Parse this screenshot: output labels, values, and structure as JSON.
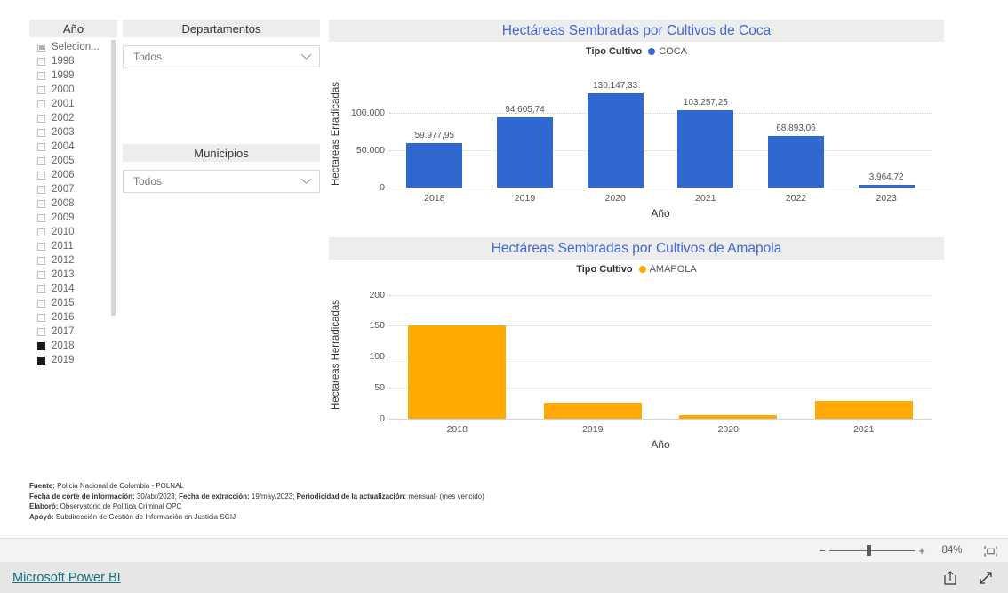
{
  "slicers": {
    "year": {
      "title": "Año",
      "items": [
        {
          "label": "Selecion...",
          "state": "indeterminate"
        },
        {
          "label": "1998",
          "state": "unchecked"
        },
        {
          "label": "1999",
          "state": "unchecked"
        },
        {
          "label": "2000",
          "state": "unchecked"
        },
        {
          "label": "2001",
          "state": "unchecked"
        },
        {
          "label": "2002",
          "state": "unchecked"
        },
        {
          "label": "2003",
          "state": "unchecked"
        },
        {
          "label": "2004",
          "state": "unchecked"
        },
        {
          "label": "2005",
          "state": "unchecked"
        },
        {
          "label": "2006",
          "state": "unchecked"
        },
        {
          "label": "2007",
          "state": "unchecked"
        },
        {
          "label": "2008",
          "state": "unchecked"
        },
        {
          "label": "2009",
          "state": "unchecked"
        },
        {
          "label": "2010",
          "state": "unchecked"
        },
        {
          "label": "2011",
          "state": "unchecked"
        },
        {
          "label": "2012",
          "state": "unchecked"
        },
        {
          "label": "2013",
          "state": "unchecked"
        },
        {
          "label": "2014",
          "state": "unchecked"
        },
        {
          "label": "2015",
          "state": "unchecked"
        },
        {
          "label": "2016",
          "state": "unchecked"
        },
        {
          "label": "2017",
          "state": "unchecked"
        },
        {
          "label": "2018",
          "state": "checked"
        },
        {
          "label": "2019",
          "state": "checked"
        }
      ]
    },
    "departamentos": {
      "title": "Departamentos",
      "value": "Todos",
      "icon": "chevron-down-icon"
    },
    "municipios": {
      "title": "Municipios",
      "value": "Todos",
      "icon": "chevron-down-icon"
    }
  },
  "chart_data": [
    {
      "type": "bar",
      "title": "Hectáreas Sembradas por Cultivos de Coca",
      "legend_title": "Tipo Cultivo",
      "legend_entries": [
        "COCA"
      ],
      "legend_position": "top",
      "color": "#2f68ce",
      "xlabel": "Año",
      "ylabel": "Hectareas Erradicadas",
      "categories": [
        "2018",
        "2019",
        "2020",
        "2021",
        "2022",
        "2023"
      ],
      "values": [
        59977.95,
        94605.74,
        130147.33,
        103257.25,
        68893.06,
        3964.72
      ],
      "value_labels": [
        "59.977,95",
        "94.605,74",
        "130.147,33",
        "103.257,25",
        "68.893,06",
        "3.964,72"
      ],
      "yticks": [
        0,
        50000,
        100000
      ],
      "ytick_labels": [
        "0",
        "50.000",
        "100.000"
      ],
      "ylim": [
        0,
        143000
      ],
      "grid": true
    },
    {
      "type": "bar",
      "title": "Hectáreas Sembradas por Cultivos de Amapola",
      "legend_title": "Tipo Cultivo",
      "legend_entries": [
        "AMAPOLA"
      ],
      "legend_position": "top",
      "color": "#ffa900",
      "xlabel": "Año",
      "ylabel": "Hectareas Herradicadas",
      "categories": [
        "2018",
        "2019",
        "2020",
        "2021"
      ],
      "values": [
        151,
        26,
        6,
        28
      ],
      "value_labels": [
        "",
        "",
        "",
        ""
      ],
      "yticks": [
        0,
        50,
        100,
        150,
        200
      ],
      "ytick_labels": [
        "0",
        "50",
        "100",
        "150",
        "200"
      ],
      "ylim": [
        0,
        208
      ],
      "grid": true
    }
  ],
  "footnotes": [
    {
      "label": "Fuente:",
      "text": " Policia Nacional de Colombia - POLNAL"
    },
    {
      "label": "Fecha de corte de información:",
      "text": " 30/abr/2023; ",
      "label2": "Fecha de extracción:",
      "text2": " 19/may/2023; ",
      "label3": "Periodicidad de la actualización:",
      "text3": " mensual- (mes vencido)"
    },
    {
      "label": "Elaboró:",
      "text": " Observatorio de Política Criminal OPC"
    },
    {
      "label": "Apoyó:",
      "text": " Subdirección de Gestión de Información en Justicia SGIJ"
    }
  ],
  "zoom_bar": {
    "minus": "−",
    "plus": "+",
    "percent": "84%",
    "fit_icon": "fit-to-page-icon"
  },
  "powerbi_bar": {
    "brand": "Microsoft Power BI",
    "share_icon": "share-icon",
    "fullscreen_icon": "fullscreen-icon"
  }
}
